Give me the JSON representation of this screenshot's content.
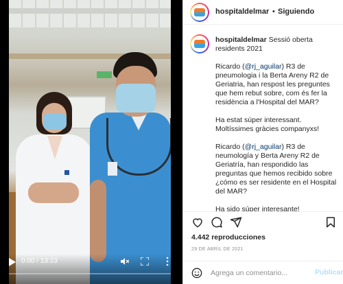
{
  "video": {
    "time": "0:00 / 13:23",
    "progress": 0.0,
    "icons": {
      "play": "play-icon",
      "mute": "muted-speaker-icon",
      "fullscreen": "fullscreen-icon",
      "more": "more-vertical-icon"
    }
  },
  "header": {
    "username": "hospitaldelmar",
    "separator": "•",
    "follow_label": "Siguiendo"
  },
  "caption": {
    "username": "hospitaldelmar",
    "title": "Sessió oberta residents 2021",
    "p1_before": "Ricardo (",
    "p1_mention1": "@rj_aguilar",
    "p1_after": ") R3 de pneumologia i la Berta Areny R2 de Geriatria, han respost les preguntes que hem rebut sobre, com és fer la residència a l'Hospital del MAR?",
    "p2": "Ha estat súper interessant. Moltíssimes gràcies companyxs!",
    "p3_before": "Ricardo (",
    "p3_mention": "@rj_aguilar",
    "p3_after": ") R3 de neumología y Berta Areny R2 de Geriatría, han respondido las preguntas que hemos recibido sobre ¿cómo es ser residente en el Hospital del MAR?",
    "p4": "Ha sido súper interesante! Muchísimas"
  },
  "actions": {
    "icons": [
      "heart-icon",
      "comment-icon",
      "share-icon",
      "bookmark-icon"
    ],
    "views": "4.442 reproducciones",
    "date": "29 DE ABRIL DE 2021"
  },
  "comment_box": {
    "placeholder": "Agrega un comentario...",
    "publish_label": "Publicar"
  },
  "colors": {
    "accent": "#0095f6",
    "publish_disabled": "#b2dffc",
    "mention": "#00376b",
    "text": "#262626",
    "muted": "#8e8e8e"
  }
}
